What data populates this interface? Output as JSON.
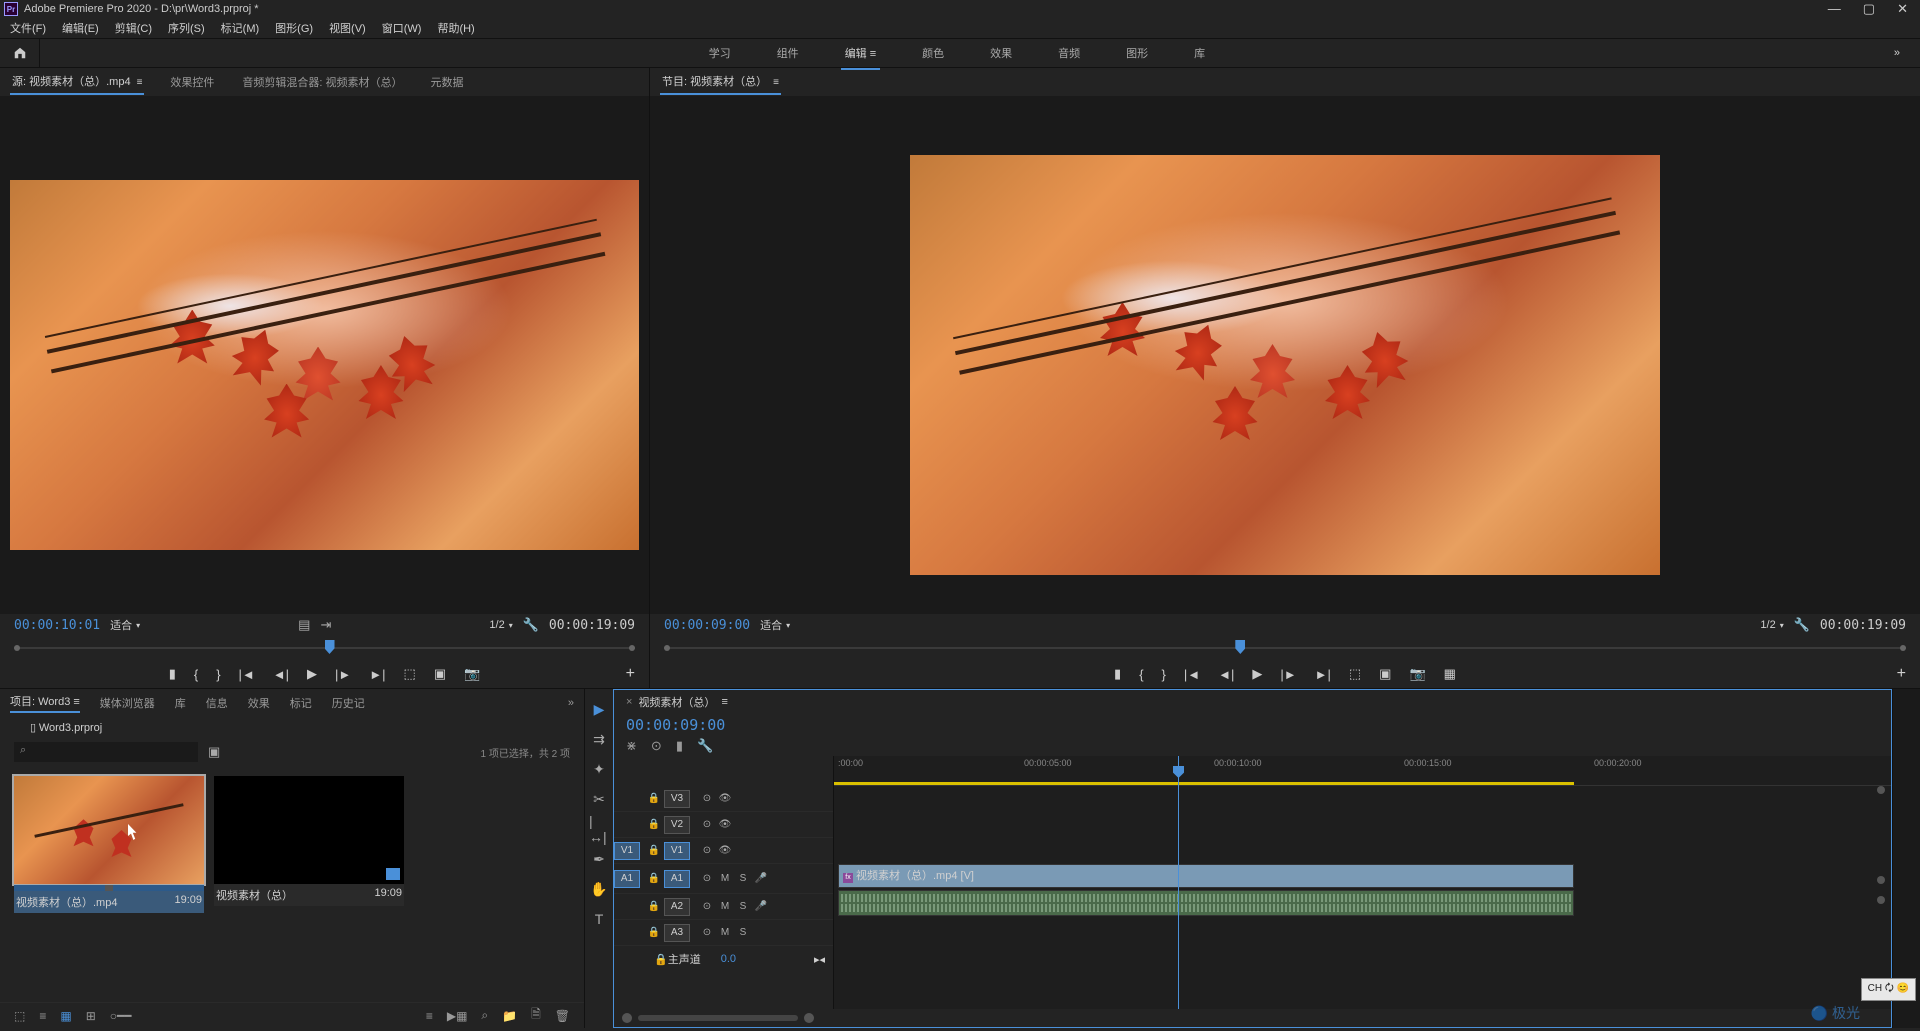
{
  "title": "Adobe Premiere Pro 2020 - D:\\pr\\Word3.prproj *",
  "menu": [
    "文件(F)",
    "编辑(E)",
    "剪辑(C)",
    "序列(S)",
    "标记(M)",
    "图形(G)",
    "视图(V)",
    "窗口(W)",
    "帮助(H)"
  ],
  "workspaces": {
    "items": [
      "学习",
      "组件",
      "编辑",
      "颜色",
      "效果",
      "音频",
      "图形",
      "库"
    ],
    "active": 2,
    "overflow": "»"
  },
  "sourcePanel": {
    "tabs": [
      "源: 视频素材（总）.mp4",
      "效果控件",
      "音频剪辑混合器: 视频素材（总）",
      "元数据"
    ],
    "active": 0,
    "timecode_in": "00:00:10:01",
    "timecode_out": "00:00:19:09",
    "fit": "适合",
    "res": "1/2"
  },
  "programPanel": {
    "title": "节目: 视频素材（总）",
    "timecode_in": "00:00:09:00",
    "timecode_out": "00:00:19:09",
    "fit": "适合",
    "res": "1/2"
  },
  "projectPanel": {
    "tabs": [
      "项目: Word3",
      "媒体浏览器",
      "库",
      "信息",
      "效果",
      "标记",
      "历史记"
    ],
    "active": 0,
    "overflow": "»",
    "projectFile": "Word3.prproj",
    "selectionInfo": "1 项已选择，共 2 项",
    "assets": [
      {
        "name": "视频素材（总）.mp4",
        "dur": "19:09",
        "type": "clip",
        "selected": true
      },
      {
        "name": "视频素材（总）",
        "dur": "19:09",
        "type": "sequence",
        "selected": false
      }
    ],
    "zoom": "0.0"
  },
  "timeline": {
    "seqname": "视频素材（总）",
    "timecode": "00:00:09:00",
    "ruler": [
      ":00:00",
      "00:00:05:00",
      "00:00:10:00",
      "00:00:15:00",
      "00:00:20:00"
    ],
    "tracks": {
      "v": [
        "V3",
        "V2",
        "V1"
      ],
      "a": [
        "A1",
        "A2",
        "A3"
      ],
      "master": "主声道",
      "master_val": "0.0"
    },
    "clip_v": "视频素材（总）.mp4 [V]",
    "src": {
      "v": "V1",
      "a": "A1"
    }
  },
  "ime": "CH 🗘 😊"
}
